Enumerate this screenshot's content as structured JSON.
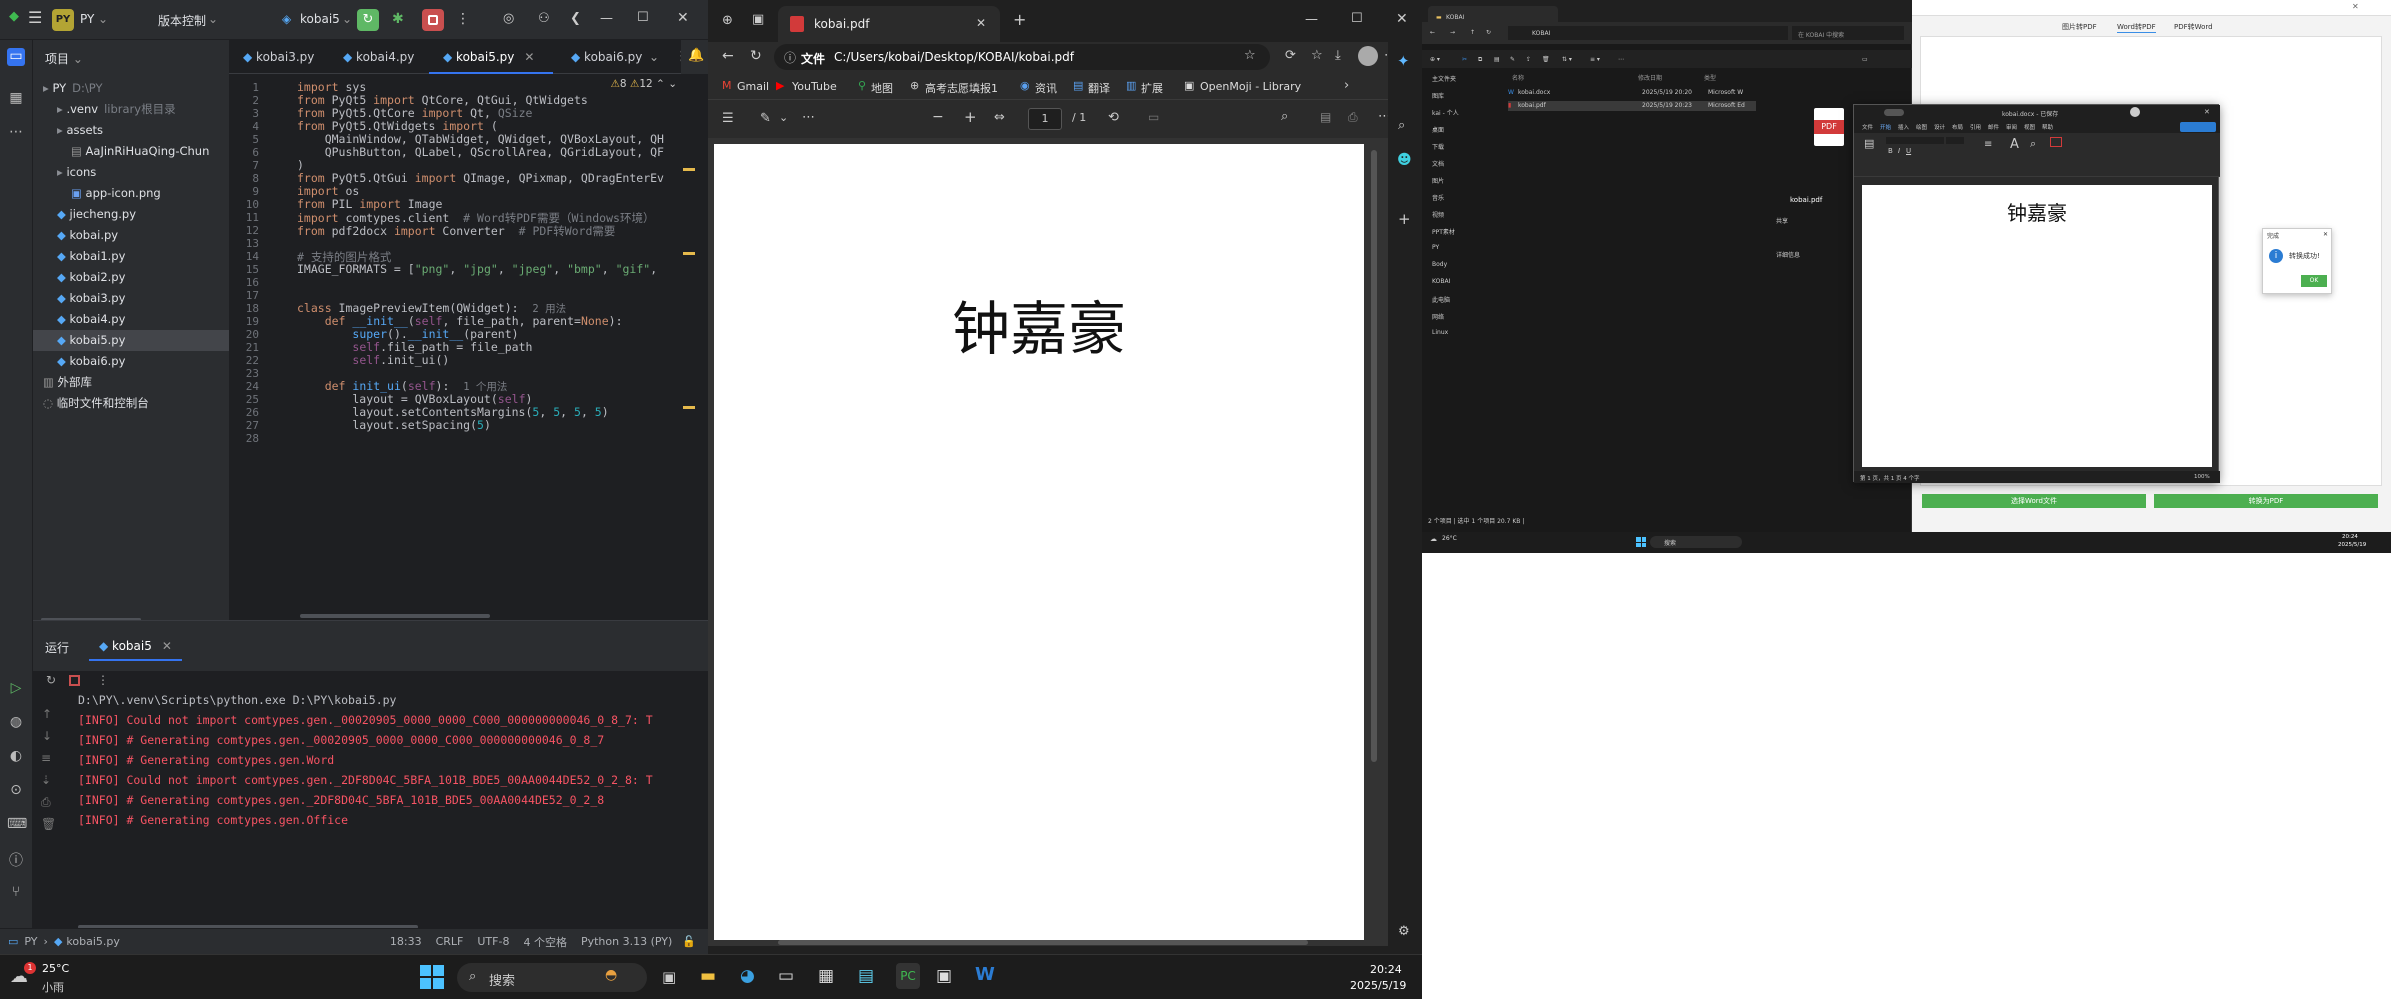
{
  "ide": {
    "project_badge": "PY",
    "project_name": "PY",
    "vcs_label": "版本控制",
    "run_config": "kobai5",
    "project_panel_title": "项目",
    "tree": [
      {
        "label": "PY",
        "extra": "D:\\PY",
        "indent": 0,
        "icon": "folder"
      },
      {
        "label": ".venv",
        "extra": "library根目录",
        "indent": 1,
        "icon": "folder"
      },
      {
        "label": "assets",
        "extra": "",
        "indent": 1,
        "icon": "folder"
      },
      {
        "label": "AaJinRiHuaQing-Chun",
        "extra": "",
        "indent": 2,
        "icon": "file"
      },
      {
        "label": "icons",
        "extra": "",
        "indent": 1,
        "icon": "folder"
      },
      {
        "label": "app-icon.png",
        "extra": "",
        "indent": 2,
        "icon": "image"
      },
      {
        "label": "jiecheng.py",
        "extra": "",
        "indent": 1,
        "icon": "py"
      },
      {
        "label": "kobai.py",
        "extra": "",
        "indent": 1,
        "icon": "py"
      },
      {
        "label": "kobai1.py",
        "extra": "",
        "indent": 1,
        "icon": "py"
      },
      {
        "label": "kobai2.py",
        "extra": "",
        "indent": 1,
        "icon": "py"
      },
      {
        "label": "kobai3.py",
        "extra": "",
        "indent": 1,
        "icon": "py"
      },
      {
        "label": "kobai4.py",
        "extra": "",
        "indent": 1,
        "icon": "py"
      },
      {
        "label": "kobai5.py",
        "extra": "",
        "indent": 1,
        "icon": "py"
      },
      {
        "label": "kobai6.py",
        "extra": "",
        "indent": 1,
        "icon": "py"
      },
      {
        "label": "外部库",
        "extra": "",
        "indent": 0,
        "icon": "lib"
      },
      {
        "label": "临时文件和控制台",
        "extra": "",
        "indent": 0,
        "icon": "scratch"
      }
    ],
    "tabs": [
      "kobai3.py",
      "kobai4.py",
      "kobai5.py",
      "kobai6.py"
    ],
    "inspection": {
      "warnings": "8",
      "weak": "12"
    },
    "code_lines": [
      {
        "n": "1",
        "html": "<span class='kw'>import</span> sys"
      },
      {
        "n": "2",
        "html": "<span class='kw'>from</span> PyQt5 <span class='kw'>import</span> QtCore, QtGui, QtWidgets"
      },
      {
        "n": "3",
        "html": "<span class='kw'>from</span> PyQt5.QtCore <span class='kw'>import</span> Qt, <span class='cm'>QSize</span>"
      },
      {
        "n": "4",
        "html": "<span class='kw'>from</span> PyQt5.QtWidgets <span class='kw'>import</span> ("
      },
      {
        "n": "5",
        "html": "    QMainWindow, QTabWidget, QWidget, QVBoxLayout, QH"
      },
      {
        "n": "6",
        "html": "    QPushButton, QLabel, QScrollArea, QGridLayout, QF"
      },
      {
        "n": "7",
        "html": ")"
      },
      {
        "n": "8",
        "html": "<span class='kw'>from</span> PyQt5.QtGui <span class='kw'>import</span> QImage, QPixmap, QDragEnterEv"
      },
      {
        "n": "9",
        "html": "<span class='kw'>import</span> os"
      },
      {
        "n": "10",
        "html": "<span class='kw'>from</span> PIL <span class='kw'>import</span> Image"
      },
      {
        "n": "11",
        "html": "<span class='kw'>import</span> comtypes.client  <span class='cm'># Word转PDF需要（Windows环境）</span>"
      },
      {
        "n": "12",
        "html": "<span class='kw'>from</span> pdf2docx <span class='kw'>import</span> Converter  <span class='cm'># PDF转Word需要</span>"
      },
      {
        "n": "13",
        "html": ""
      },
      {
        "n": "14",
        "html": "<span class='cm'># 支持的图片格式</span>"
      },
      {
        "n": "15",
        "html": "IMAGE_FORMATS = [<span class='st'>\"png\"</span>, <span class='st'>\"jpg\"</span>, <span class='st'>\"jpeg\"</span>, <span class='st'>\"bmp\"</span>, <span class='st'>\"gif\"</span>,"
      },
      {
        "n": "16",
        "html": ""
      },
      {
        "n": "17",
        "html": ""
      },
      {
        "n": "18",
        "html": "<span class='kw'>class</span> ImagePreviewItem(QWidget):  <span class='hint'>2 用法</span>"
      },
      {
        "n": "19",
        "html": "    <span class='kw'>def</span> <span class='fn'>__init__</span>(<span class='sf'>self</span>, file_path, parent=<span class='kw'>None</span>):"
      },
      {
        "n": "20",
        "html": "        <span class='fn'>super</span>().<span class='fn'>__init__</span>(parent)"
      },
      {
        "n": "21",
        "html": "        <span class='sf'>self</span>.file_path = file_path"
      },
      {
        "n": "22",
        "html": "        <span class='sf'>self</span>.init_ui()"
      },
      {
        "n": "23",
        "html": ""
      },
      {
        "n": "24",
        "html": "    <span class='kw'>def</span> <span class='fn'>init_ui</span>(<span class='sf'>self</span>):  <span class='hint'>1 个用法</span>"
      },
      {
        "n": "25",
        "html": "        layout = QVBoxLayout(<span class='sf'>self</span>)"
      },
      {
        "n": "26",
        "html": "        layout.setContentsMargins(<span class='nm'>5</span>, <span class='nm'>5</span>, <span class='nm'>5</span>, <span class='nm'>5</span>)"
      },
      {
        "n": "27",
        "html": "        layout.setSpacing(<span class='nm'>5</span>)"
      },
      {
        "n": "28",
        "html": ""
      }
    ],
    "run_panel_title": "运行",
    "run_tab": "kobai5",
    "run_output": [
      {
        "text": "D:\\PY\\.venv\\Scripts\\python.exe D:\\PY\\kobai5.py",
        "kind": "cmd"
      },
      {
        "text": "[INFO] Could not import comtypes.gen._00020905_0000_0000_C000_000000000046_0_8_7: T",
        "kind": "err"
      },
      {
        "text": "[INFO] # Generating comtypes.gen._00020905_0000_0000_C000_000000000046_0_8_7",
        "kind": "err"
      },
      {
        "text": "[INFO] # Generating comtypes.gen.Word",
        "kind": "err"
      },
      {
        "text": "[INFO] Could not import comtypes.gen._2DF8D04C_5BFA_101B_BDE5_00AA0044DE52_0_2_8: T",
        "kind": "err"
      },
      {
        "text": "[INFO] # Generating comtypes.gen._2DF8D04C_5BFA_101B_BDE5_00AA0044DE52_0_2_8",
        "kind": "err"
      },
      {
        "text": "[INFO] # Generating comtypes.gen.Office",
        "kind": "err"
      }
    ],
    "status": {
      "crumb_project": "PY",
      "crumb_file": "kobai5.py",
      "position": "18:33",
      "line_sep": "CRLF",
      "encoding": "UTF-8",
      "indent": "4 个空格",
      "interpreter": "Python 3.13 (PY)"
    }
  },
  "taskbar": {
    "weather_temp": "25°C",
    "weather_desc": "小雨",
    "weather_badge": "1",
    "search_placeholder": "搜索",
    "time": "20:24",
    "date": "2025/5/19"
  },
  "browser": {
    "tab_title": "kobai.pdf",
    "url_label": "文件",
    "url": "C:/Users/kobai/Desktop/KOBAI/kobai.pdf",
    "bookmarks": [
      "Gmail",
      "YouTube",
      "地图",
      "高考志愿填报1",
      "资讯",
      "翻译",
      "扩展",
      "OpenMoji - Library"
    ],
    "page_current": "1",
    "page_total": "/ 1",
    "pdf_text": "钟嘉豪"
  },
  "right_screenshot": {
    "explorer_title": "KOBAI",
    "explorer_path": "KOBAI",
    "explorer_search": "在 KOBAI 中搜索",
    "explorer_nav": [
      "主文件夹",
      "图库",
      "kai - 个人",
      "桌面",
      "下载",
      "文档",
      "图片",
      "音乐",
      "视频",
      "PPT素材",
      "PY",
      "Body",
      "KOBAI",
      "此电脑",
      "网络",
      "Linux"
    ],
    "explorer_cols": [
      "名称",
      "修改日期",
      "类型"
    ],
    "explorer_files": [
      {
        "name": "kobai.docx",
        "date": "2025/5/19 20:20",
        "type": "Microsoft W"
      },
      {
        "name": "kobai.pdf",
        "date": "2025/5/19 20:23",
        "type": "Microsoft Ed"
      }
    ],
    "explorer_status": "2 个项目  |  选中 1 个项目  20.7 KB  |",
    "detail_title": "kobai.pdf",
    "detail_share": "共享",
    "detail_label": "详细信息",
    "converter_tabs": [
      "图片转PDF",
      "Word转PDF",
      "PDF转Word"
    ],
    "converter_btn_select": "选择Word文件",
    "converter_btn_convert": "转换为PDF",
    "word_title": "kobai.docx - 已保存",
    "word_menu": [
      "文件",
      "开始",
      "插入",
      "绘图",
      "设计",
      "布局",
      "引用",
      "邮件",
      "审阅",
      "视图",
      "帮助"
    ],
    "word_doc_text": "钟嘉豪",
    "word_status": "第 1 页，共 1 页   4 个字",
    "word_zoom": "100%",
    "msg_title": "完成",
    "msg_text": "转换成功!",
    "msg_ok": "OK",
    "mini_time": "20:24",
    "mini_date": "2025/5/19",
    "mini_weather": "26°C",
    "mini_search": "搜索"
  },
  "colors": {
    "ide_bg": "#1e1f22",
    "ide_panel": "#2b2d30",
    "accent": "#3574f0",
    "error_text": "#f75464",
    "run_green": "#5fb865",
    "converter_green": "#4caf50"
  }
}
